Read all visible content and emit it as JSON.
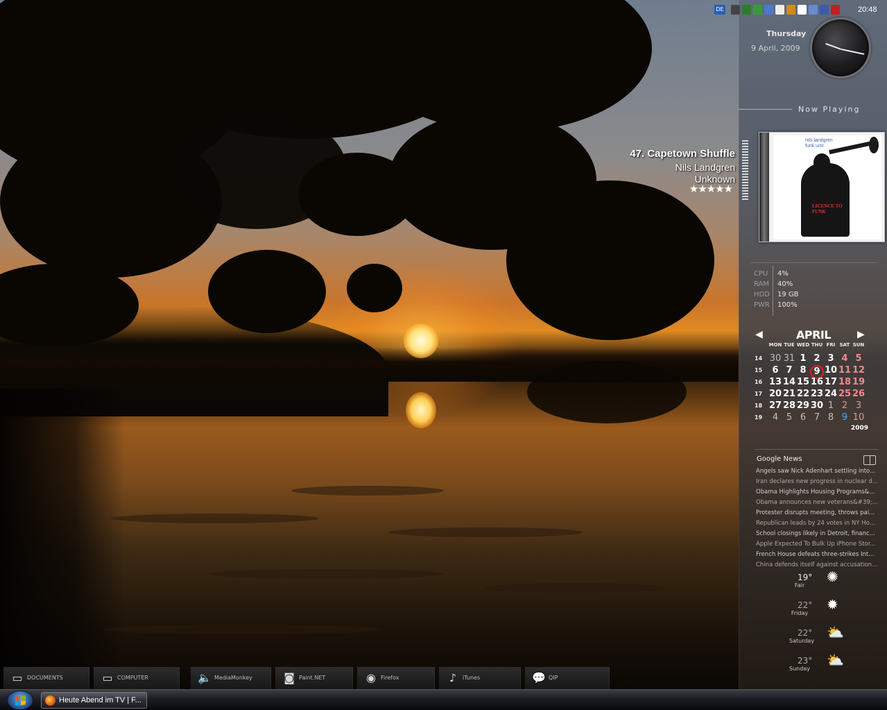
{
  "widgets": {
    "date": {
      "day": "Thursday",
      "full": "9 April, 2009"
    },
    "now_playing": {
      "label": "Now Playing",
      "title": "47. Capetown Shuffle",
      "artist": "Nils Landgren",
      "album": "Unknown",
      "rating": "★★★★★",
      "cover": {
        "title": "nils landgren\nfunk unit",
        "red_text": "LICENCE TO\nFUNK"
      }
    },
    "stats": [
      {
        "key": "CPU",
        "value": "4%"
      },
      {
        "key": "RAM",
        "value": "40%"
      },
      {
        "key": "HDD",
        "value": "19 GB"
      },
      {
        "key": "PWR",
        "value": "100%"
      }
    ],
    "calendar": {
      "month": "APRIL",
      "year": "2009",
      "prev": "◀",
      "next": "▶",
      "headers": [
        "MON",
        "TUE",
        "WED",
        "THU",
        "FRI",
        "SAT",
        "SUN"
      ],
      "weeks": [
        {
          "num": "14",
          "days": [
            "30",
            "31",
            "1",
            "2",
            "3",
            "4",
            "5"
          ]
        },
        {
          "num": "15",
          "days": [
            "6",
            "7",
            "8",
            "9",
            "10",
            "11",
            "12"
          ]
        },
        {
          "num": "16",
          "days": [
            "13",
            "14",
            "15",
            "16",
            "17",
            "18",
            "19"
          ]
        },
        {
          "num": "17",
          "days": [
            "20",
            "21",
            "22",
            "23",
            "24",
            "25",
            "26"
          ]
        },
        {
          "num": "18",
          "days": [
            "27",
            "28",
            "29",
            "30",
            "1",
            "2",
            "3"
          ]
        },
        {
          "num": "19",
          "days": [
            "4",
            "5",
            "6",
            "7",
            "8",
            "9",
            "10"
          ]
        }
      ],
      "today": "9"
    },
    "news": {
      "title": "Google News",
      "items": [
        "Angels saw Nick Adenhart settling into...",
        "Iran declares new progress in nuclear d...",
        "Obama Highlights Housing Programs&#...",
        "Obama announces new veterans&#39;...",
        "Protester disrupts meeting, throws pai...",
        "Republican leads by 24 votes in NY Hou...",
        "School closings likely in Detroit, financ...",
        "Apple Expected To Bulk Up iPhone Stor...",
        "French House defeats three-strikes Int...",
        "China defends itself against accusation..."
      ]
    },
    "weather": [
      {
        "temp": "19°",
        "label": "Fair",
        "icon": "sun-icon",
        "glyph": "✺"
      },
      {
        "temp": "22°",
        "label": "Friday",
        "icon": "sun-icon",
        "glyph": "✹"
      },
      {
        "temp": "22°",
        "label": "Saturday",
        "icon": "partly-cloudy-icon",
        "glyph": "⛅"
      },
      {
        "temp": "23°",
        "label": "Sunday",
        "icon": "partly-cloudy-icon",
        "glyph": "⛅"
      }
    ]
  },
  "dock": [
    {
      "label": "DOCUMENTS",
      "icon": "folder-icon",
      "glyph": "▭"
    },
    {
      "label": "COMPUTER",
      "icon": "computer-icon",
      "glyph": "▭"
    },
    {
      "label": "MediaMonkey",
      "icon": "speaker-icon",
      "glyph": "🔈"
    },
    {
      "label": "Paint.NET",
      "icon": "camera-icon",
      "glyph": "◙"
    },
    {
      "label": "Firefox",
      "icon": "firefox-icon",
      "glyph": "◉"
    },
    {
      "label": "iTunes",
      "icon": "itunes-icon",
      "glyph": "♪"
    },
    {
      "label": "QIP",
      "icon": "chat-icon",
      "glyph": "💬"
    }
  ],
  "taskbar": {
    "task": "Heute Abend im TV | F...",
    "tray_lang": "DE",
    "time": "20:48",
    "tray_icons": [
      "arrow-icon",
      "network-icon",
      "icq-icon",
      "info-icon",
      "skype-icon",
      "nine-icon",
      "tools-icon",
      "speaker-icon",
      "monitor-icon",
      "security-icon"
    ]
  },
  "colors": {
    "today_ring": "#e02020",
    "weekend": "#f08a8a",
    "accent_blue": "#4aa8ff"
  }
}
